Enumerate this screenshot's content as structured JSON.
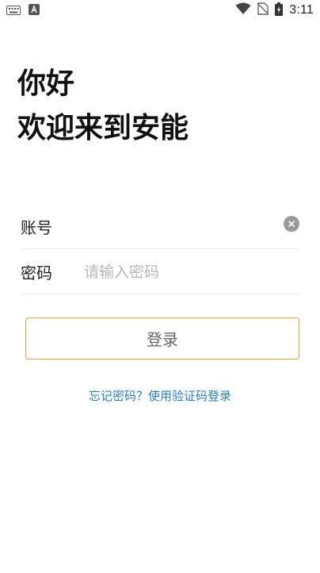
{
  "status_bar": {
    "time": "3:11",
    "icons": [
      "keyboard-icon",
      "accessibility-a-icon",
      "wifi-icon",
      "no-sim-icon",
      "battery-icon"
    ]
  },
  "greeting": {
    "line1": "你好",
    "line2": "欢迎来到安能"
  },
  "form": {
    "account_label": "账号",
    "account_value": "",
    "password_label": "密码",
    "password_placeholder": "请输入密码",
    "password_value": ""
  },
  "login_button": {
    "label": "登录",
    "border_color": "#d9a63a"
  },
  "forgot": {
    "text": "忘记密码？使用验证码登录",
    "color": "#2b7fc6"
  }
}
